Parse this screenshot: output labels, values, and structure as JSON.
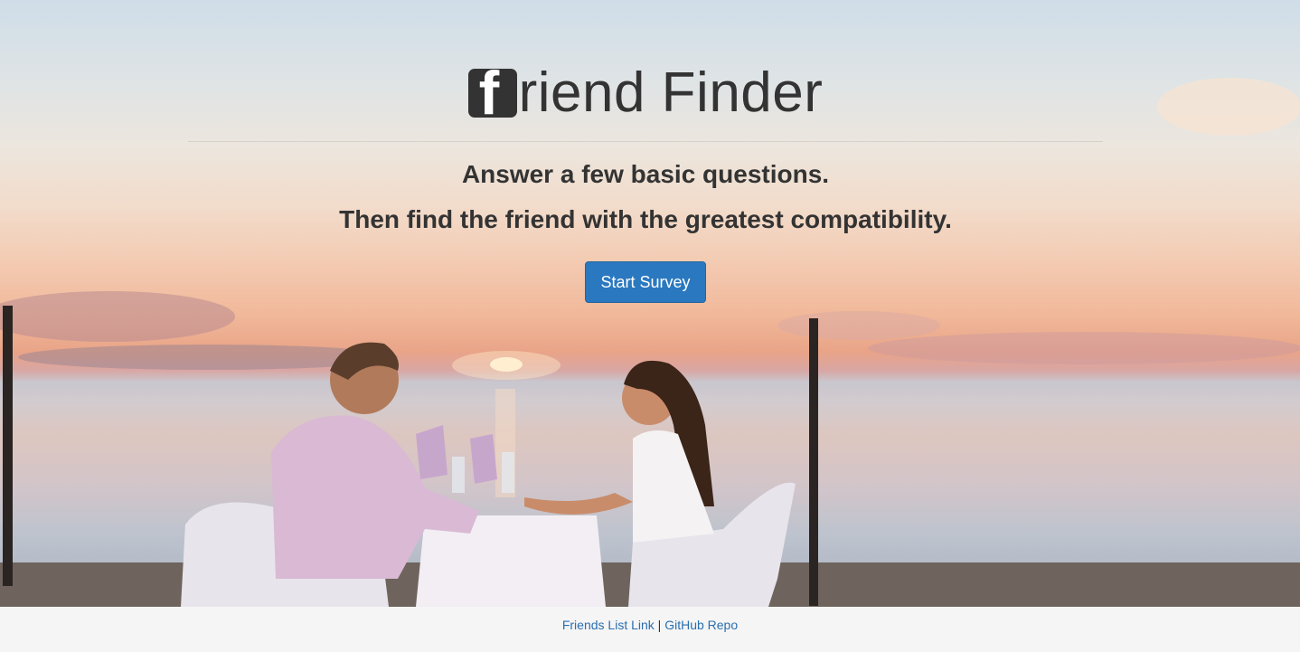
{
  "hero": {
    "brand_letter": "f",
    "brand_text": "riend Finder",
    "subtitle_1": "Answer a few basic questions.",
    "subtitle_2": "Then find the friend with the greatest compatibility.",
    "cta_label": "Start Survey",
    "background_image": "couple-dinner-beach-sunset"
  },
  "footer": {
    "link_friends": "Friends List Link",
    "separator": "|",
    "link_github": "GitHub Repo"
  },
  "colors": {
    "primary_button": "#2a78bf",
    "text": "#333333",
    "link": "#2a6fb0",
    "footer_bg": "#f5f5f5"
  }
}
